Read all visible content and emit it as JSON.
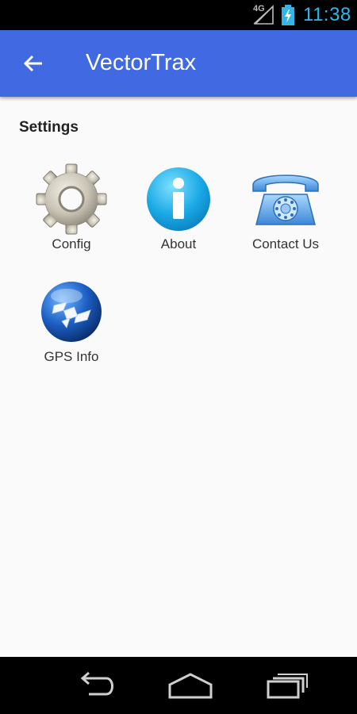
{
  "status_bar": {
    "network": "4G",
    "time": "11:38",
    "icons": [
      "signal-icon",
      "battery-charging-icon"
    ]
  },
  "app_bar": {
    "title": "VectorTrax",
    "back_icon": "arrow-left-icon"
  },
  "section": {
    "title": "Settings"
  },
  "tiles": [
    {
      "label": "Config",
      "icon": "gear-icon"
    },
    {
      "label": "About",
      "icon": "info-icon"
    },
    {
      "label": "Contact Us",
      "icon": "telephone-icon"
    },
    {
      "label": "GPS Info",
      "icon": "satellite-globe-icon"
    }
  ],
  "nav_bar": {
    "icons": [
      "back-nav-icon",
      "home-nav-icon",
      "recent-apps-icon"
    ]
  },
  "colors": {
    "app_bar": "#4169e1",
    "status_accent": "#33b5e5",
    "background": "#fafafa"
  }
}
